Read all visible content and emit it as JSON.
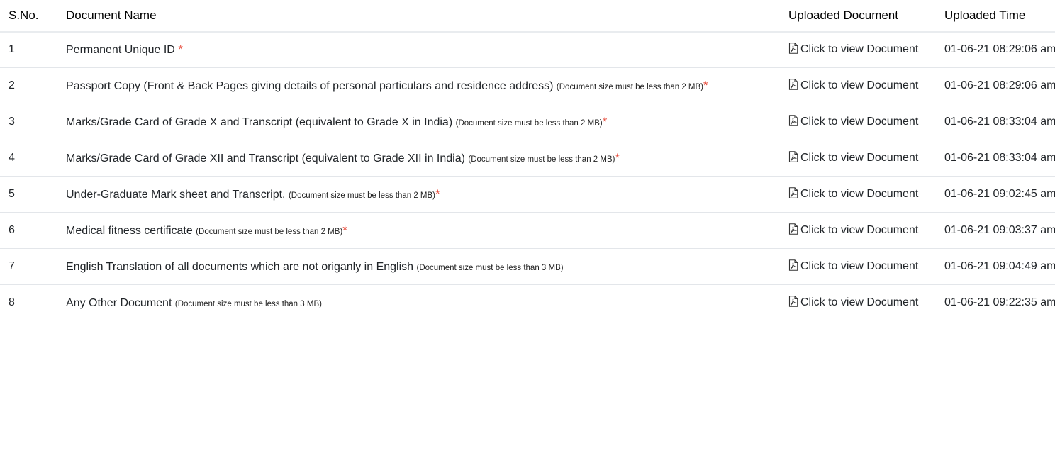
{
  "table": {
    "headers": {
      "sno": "S.No.",
      "name": "Document Name",
      "uploaded_document": "Uploaded Document",
      "uploaded_time": "Uploaded Time"
    },
    "link_icon": "pdf-file-icon",
    "required_color": "#e74c3c",
    "rows": [
      {
        "sno": "1",
        "name": "Permanent Unique ID",
        "note": "",
        "required": "*",
        "link": "Click to view Document",
        "time": "01-06-21 08:29:06 am"
      },
      {
        "sno": "2",
        "name": "Passport Copy (Front & Back Pages giving details of personal particulars and residence address)",
        "note": "(Document size must be less than 2 MB)",
        "required": "*",
        "link": "Click to view Document",
        "time": "01-06-21 08:29:06 am"
      },
      {
        "sno": "3",
        "name": "Marks/Grade Card of Grade X and Transcript (equivalent to Grade X in India)",
        "note": "(Document size must be less than 2 MB)",
        "required": "*",
        "link": "Click to view Document",
        "time": "01-06-21 08:33:04 am"
      },
      {
        "sno": "4",
        "name": "Marks/Grade Card of Grade XII and Transcript (equivalent to Grade XII in India)",
        "note": "(Document size must be less than 2 MB)",
        "required": "*",
        "link": "Click to view Document",
        "time": "01-06-21 08:33:04 am"
      },
      {
        "sno": "5",
        "name": "Under-Graduate Mark sheet and Transcript.",
        "note": "(Document size must be less than 2 MB)",
        "required": "*",
        "link": "Click to view Document",
        "time": "01-06-21 09:02:45 am"
      },
      {
        "sno": "6",
        "name": "Medical fitness certificate",
        "note": "(Document size must be less than 2 MB)",
        "required": "*",
        "link": "Click to view Document",
        "time": "01-06-21 09:03:37 am"
      },
      {
        "sno": "7",
        "name": "English Translation of all documents which are not origanly in English",
        "note": "(Document size must be less than 3 MB)",
        "required": "",
        "link": "Click to view Document",
        "time": "01-06-21 09:04:49 am"
      },
      {
        "sno": "8",
        "name": "Any Other Document",
        "note": "(Document size must be less than 3 MB)",
        "required": "",
        "link": "Click to view Document",
        "time": "01-06-21 09:22:35 am"
      }
    ]
  }
}
